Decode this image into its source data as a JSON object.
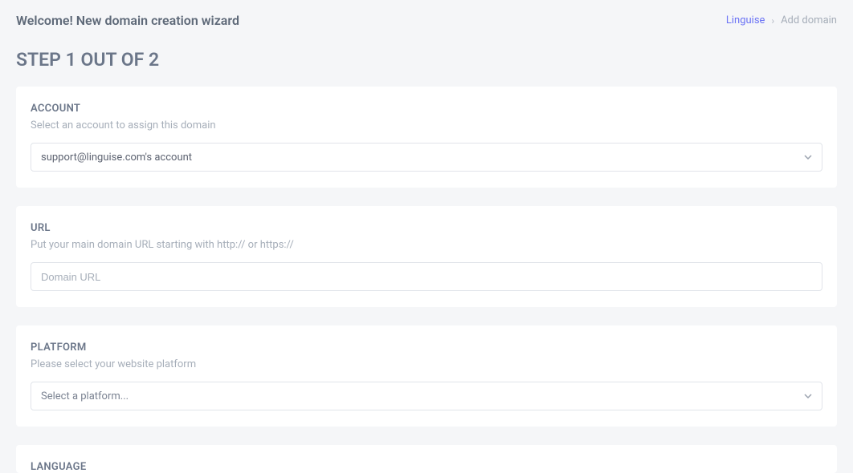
{
  "header": {
    "title": "Welcome! New domain creation wizard",
    "breadcrumb": {
      "link": "Linguise",
      "current": "Add domain"
    }
  },
  "step_title": "STEP 1 OUT OF 2",
  "sections": {
    "account": {
      "label": "ACCOUNT",
      "desc": "Select an account to assign this domain",
      "selected": "support@linguise.com's account"
    },
    "url": {
      "label": "URL",
      "desc": "Put your main domain URL starting with http:// or https://",
      "placeholder": "Domain URL"
    },
    "platform": {
      "label": "PLATFORM",
      "desc": "Please select your website platform",
      "selected": "Select a platform..."
    },
    "language": {
      "label": "LANGUAGE"
    }
  }
}
